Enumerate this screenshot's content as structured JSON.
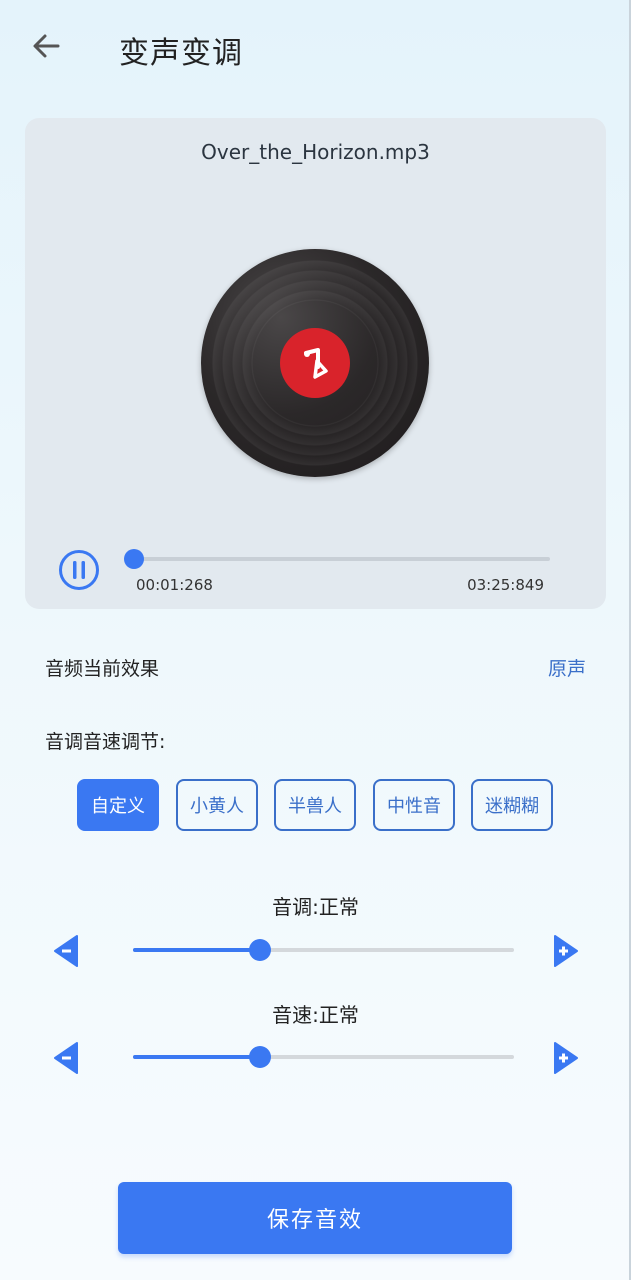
{
  "header": {
    "title": "变声变调",
    "back_icon": "arrow-left-icon"
  },
  "player": {
    "file_name": "Over_the_Horizon.mp3",
    "current_time": "00:01:268",
    "total_time": "03:25:849",
    "progress": 0.005,
    "state": "playing",
    "colors": {
      "accent": "#3a78f2",
      "disc_label": "#d9232b"
    }
  },
  "effect": {
    "label": "音频当前效果",
    "value": "原声"
  },
  "adjust": {
    "label": "音调音速调节:",
    "presets": [
      {
        "label": "自定义",
        "active": true
      },
      {
        "label": "小黄人",
        "active": false
      },
      {
        "label": "半兽人",
        "active": false
      },
      {
        "label": "中性音",
        "active": false
      },
      {
        "label": "迷糊糊",
        "active": false
      }
    ]
  },
  "sliders": [
    {
      "caption": "音调:正常",
      "value": 0.333
    },
    {
      "caption": "音速:正常",
      "value": 0.333
    }
  ],
  "save_button": {
    "label": "保存音效"
  }
}
